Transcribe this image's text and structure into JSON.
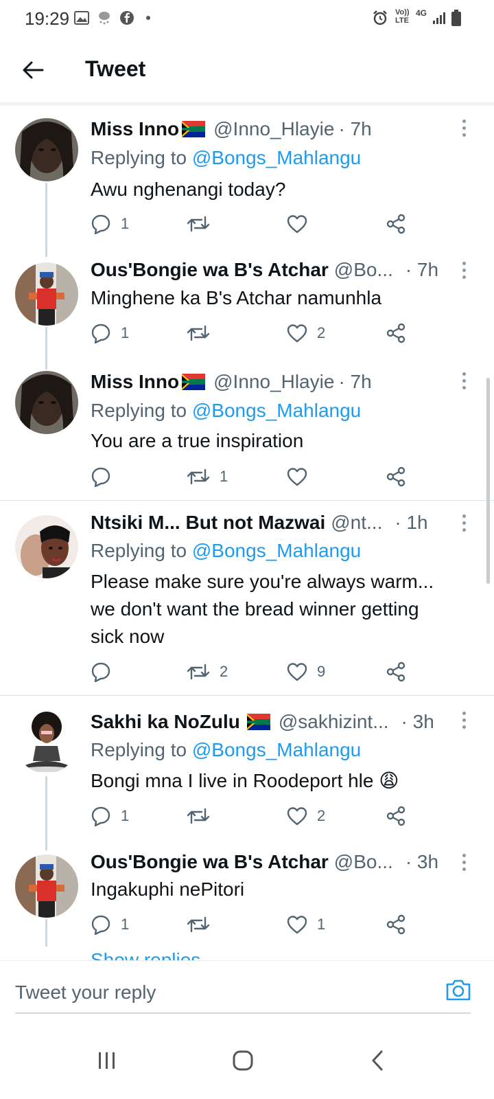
{
  "status_bar": {
    "time": "19:29",
    "icons_left": [
      "gallery-icon",
      "weather-icon",
      "facebook-icon",
      "dot-icon"
    ],
    "icons_right": [
      "alarm-icon",
      "volte-icon",
      "4g-icon",
      "signal-icon",
      "battery-icon"
    ],
    "volte_label": "Vo)) LTE",
    "network_label": "4G"
  },
  "header": {
    "title": "Tweet"
  },
  "tweets": [
    {
      "name": "Miss Inno",
      "flag": true,
      "handle": "@Inno_Hlayie",
      "time": "· 7h",
      "replying_prefix": "Replying to",
      "replying_to": "@Bongs_Mahlangu",
      "text": "Awu nghenangi today?",
      "replies": "1",
      "retweets": "",
      "likes": ""
    },
    {
      "name": "Ous'Bongie wa B's Atchar",
      "flag": false,
      "handle": "@Bo...",
      "time": "· 7h",
      "text": "Minghene ka B's Atchar namunhla",
      "replies": "1",
      "retweets": "",
      "likes": "2"
    },
    {
      "name": "Miss Inno",
      "flag": true,
      "handle": "@Inno_Hlayie",
      "time": "· 7h",
      "replying_prefix": "Replying to",
      "replying_to": "@Bongs_Mahlangu",
      "text": "You are a true inspiration",
      "replies": "",
      "retweets": "1",
      "likes": ""
    },
    {
      "name": "Ntsiki M... But not Mazwai",
      "flag": false,
      "handle": "@nt...",
      "time": "· 1h",
      "replying_prefix": "Replying to",
      "replying_to": "@Bongs_Mahlangu",
      "text_lines": [
        "Please make sure you're always warm...",
        "we don't want the bread winner getting",
        "sick now"
      ],
      "replies": "",
      "retweets": "2",
      "likes": "9"
    },
    {
      "name": "Sakhi ka NoZulu",
      "flag": true,
      "handle": "@sakhizint...",
      "time": "· 3h",
      "replying_prefix": "Replying to",
      "replying_to": "@Bongs_Mahlangu",
      "text": "Bongi mna I live in Roodeport hle",
      "emoji": "😩",
      "replies": "1",
      "retweets": "",
      "likes": "2"
    },
    {
      "name": "Ous'Bongie wa B's Atchar",
      "flag": false,
      "handle": "@Bo...",
      "time": "· 3h",
      "text": "Ingakuphi nePitori",
      "replies": "1",
      "retweets": "",
      "likes": "1"
    }
  ],
  "show_replies": "Show replies",
  "composer": {
    "placeholder": "Tweet your reply"
  },
  "nav": [
    "recents-icon",
    "home-icon",
    "back-icon"
  ],
  "colors": {
    "accent": "#1d9bf0",
    "secondary_text": "#536471",
    "primary_text": "#0f1419"
  }
}
